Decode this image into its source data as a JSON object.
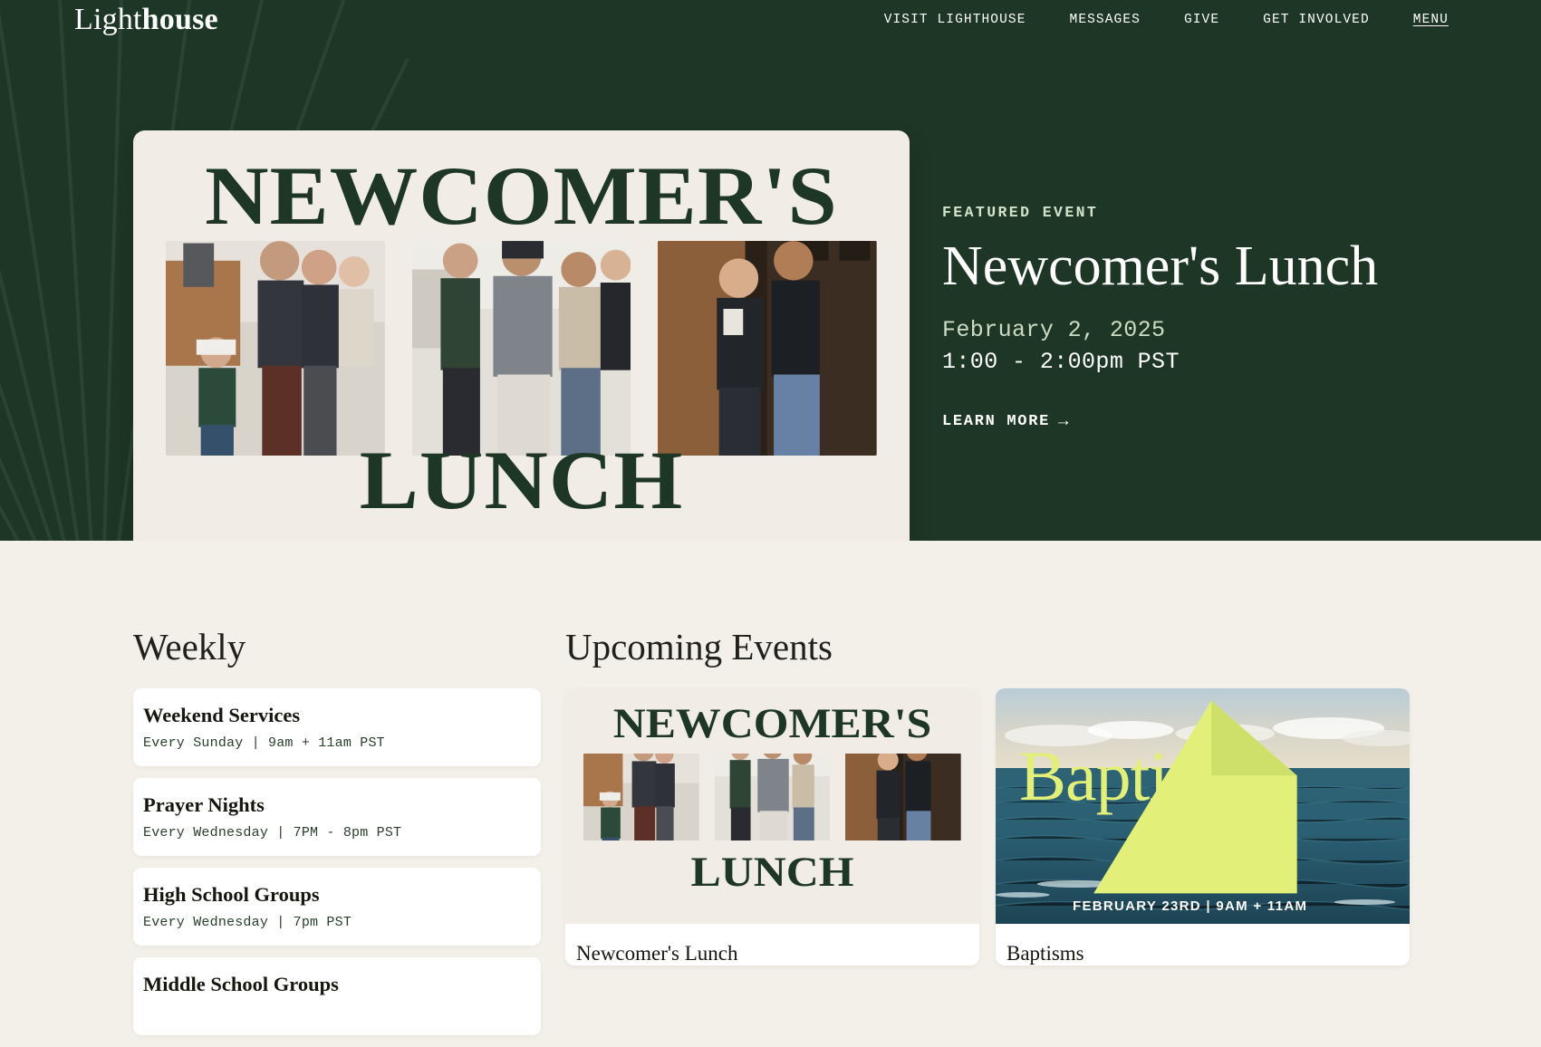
{
  "colors": {
    "hero_green": "#1e3626",
    "cream": "#f3efe9",
    "card_cream": "#f1ede6",
    "sage": "#cddcc2",
    "chartreuse": "#e2f07a",
    "white": "#ffffff",
    "ink": "#16160f"
  },
  "header": {
    "logo_light": "Light",
    "logo_bold": "house",
    "nav": [
      {
        "label": "VISIT LIGHTHOUSE",
        "name": "nav-visit-lighthouse",
        "underline": false
      },
      {
        "label": "MESSAGES",
        "name": "nav-messages",
        "underline": false
      },
      {
        "label": "GIVE",
        "name": "nav-give",
        "underline": false
      },
      {
        "label": "GET INVOLVED",
        "name": "nav-get-involved",
        "underline": false
      },
      {
        "label": "MENU",
        "name": "nav-menu",
        "underline": true
      }
    ]
  },
  "hero": {
    "poster": {
      "line1": "NEWCOMER'S",
      "line2": "LUNCH",
      "photo_alt_1": "church-lobby-family-photo",
      "photo_alt_2": "church-lobby-men-talking-photo",
      "photo_alt_3": "church-lobby-two-women-photo"
    },
    "eyebrow": "FEATURED EVENT",
    "title": "Newcomer's Lunch",
    "date": "February 2, 2025",
    "time": "1:00 - 2:00pm PST",
    "cta_label": "LEARN MORE",
    "cta_arrow": "→"
  },
  "weekly": {
    "heading": "Weekly",
    "items": [
      {
        "title": "Weekend Services",
        "schedule": "Every Sunday | 9am + 11am PST"
      },
      {
        "title": "Prayer Nights",
        "schedule": "Every Wednesday | 7PM - 8pm PST"
      },
      {
        "title": "High School Groups",
        "schedule": "Every Wednesday | 7pm PST"
      },
      {
        "title": "Middle School Groups",
        "schedule": ""
      }
    ]
  },
  "upcoming": {
    "heading": "Upcoming Events",
    "events": [
      {
        "title": "Newcomer's Lunch",
        "thumb_type": "poster",
        "poster_line1": "NEWCOMER'S",
        "poster_line2": "LUNCH"
      },
      {
        "title": "Baptisms",
        "thumb_type": "ocean",
        "overlay_title": "Baptisms",
        "overlay_date": "FEBRUARY 23RD  |  9AM + 11AM"
      }
    ]
  }
}
